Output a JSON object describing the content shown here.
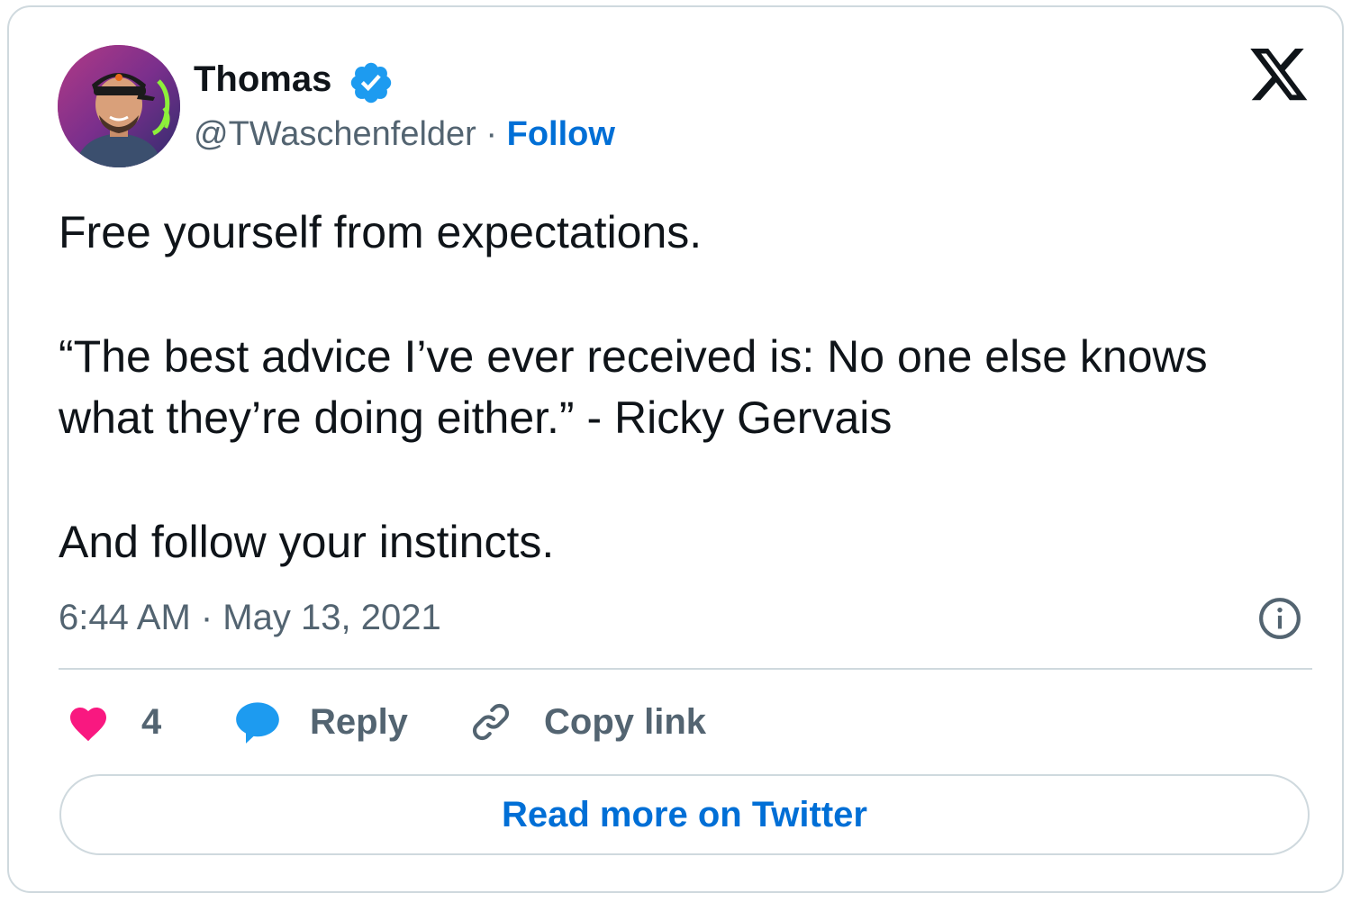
{
  "author": {
    "display_name": "Thomas",
    "handle": "@TWaschenfelder",
    "separator": "·",
    "follow_label": "Follow",
    "verified": true,
    "avatar_icon": "profile-photo"
  },
  "brand": {
    "logo_icon": "x-logo"
  },
  "tweet": {
    "paragraph_1": "Free yourself from expectations.",
    "paragraph_2": "“The best advice I’ve ever received is: No one else knows what they’re doing either.” - Ricky Gervais",
    "paragraph_3": "And follow your instincts.",
    "timestamp": "6:44 AM · May 13, 2021",
    "info_icon": "info-icon"
  },
  "actions": {
    "like_count": "4",
    "reply_label": "Reply",
    "copy_link_label": "Copy link"
  },
  "footer": {
    "read_more_label": "Read more on Twitter"
  },
  "colors": {
    "accent": "#006fd6",
    "verified": "#1d9bf0",
    "like": "#f91880",
    "reply": "#1d9bf0",
    "secondary_text": "#536471",
    "border": "#cfd9de"
  }
}
